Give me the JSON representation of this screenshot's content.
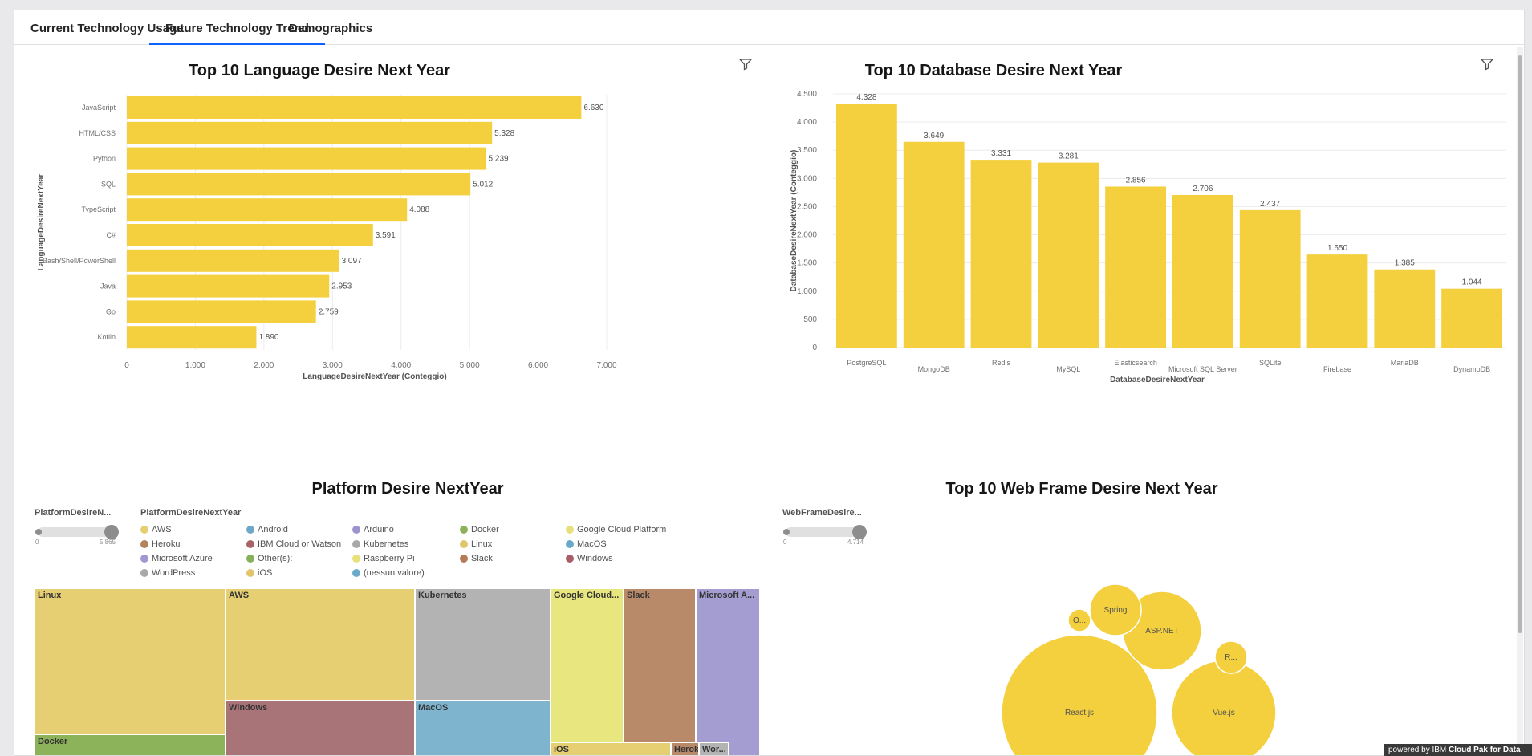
{
  "tabs": [
    {
      "label": "Current Technology Usage"
    },
    {
      "label": "Future Technology Trend"
    },
    {
      "label": "Demographics"
    }
  ],
  "colors": {
    "bar": "#f4d03f",
    "tab_accent": "#0f62fe"
  },
  "charts": {
    "language": {
      "title": "Top 10 Language Desire Next Year",
      "xlabel": "LanguageDesireNextYear (Conteggio)",
      "ylabel": "LanguageDesireNextYear"
    },
    "database": {
      "title": "Top 10 Database Desire Next Year",
      "xlabel": "DatabaseDesireNextYear",
      "ylabel": "DatabaseDesireNextYear (Conteggio)"
    },
    "platform": {
      "title": "Platform Desire NextYear",
      "slider_label": "PlatformDesireN...",
      "slider_min": "0",
      "slider_max": "5.865",
      "legend_title": "PlatformDesireNextYear"
    },
    "webframe": {
      "title": "Top 10 Web Frame Desire Next Year",
      "slider_label": "WebFrameDesire...",
      "slider_min": "0",
      "slider_max": "4.714"
    }
  },
  "chart_data": [
    {
      "type": "bar",
      "orientation": "horizontal",
      "title": "Top 10 Language Desire Next Year",
      "xlabel": "LanguageDesireNextYear (Conteggio)",
      "ylabel": "LanguageDesireNextYear",
      "categories": [
        "JavaScript",
        "HTML/CSS",
        "Python",
        "SQL",
        "TypeScript",
        "C#",
        "Bash/Shell/PowerShell",
        "Java",
        "Go",
        "Kotlin"
      ],
      "values": [
        6630,
        5328,
        5239,
        5012,
        4088,
        3591,
        3097,
        2953,
        2759,
        1890
      ],
      "value_labels": [
        "6.630",
        "5.328",
        "5.239",
        "5.012",
        "4.088",
        "3.591",
        "3.097",
        "2.953",
        "2.759",
        "1.890"
      ],
      "xlim": [
        0,
        7000
      ],
      "ticks": [
        "0",
        "1.000",
        "2.000",
        "3.000",
        "4.000",
        "5.000",
        "6.000",
        "7.000"
      ],
      "grid": true
    },
    {
      "type": "bar",
      "orientation": "vertical",
      "title": "Top 10 Database Desire Next Year",
      "xlabel": "DatabaseDesireNextYear",
      "ylabel": "DatabaseDesireNextYear (Conteggio)",
      "categories": [
        "PostgreSQL",
        "MongoDB",
        "Redis",
        "MySQL",
        "Elasticsearch",
        "Microsoft SQL Server",
        "SQLite",
        "Firebase",
        "MariaDB",
        "DynamoDB"
      ],
      "values": [
        4328,
        3649,
        3331,
        3281,
        2856,
        2706,
        2437,
        1650,
        1385,
        1044
      ],
      "value_labels": [
        "4.328",
        "3.649",
        "3.331",
        "3.281",
        "2.856",
        "2.706",
        "2.437",
        "1.650",
        "1.385",
        "1.044"
      ],
      "ylim": [
        0,
        4500
      ],
      "ticks": [
        "0",
        "500",
        "1.000",
        "1.500",
        "2.000",
        "2.500",
        "3.000",
        "3.500",
        "4.000",
        "4.500"
      ],
      "grid": true
    },
    {
      "type": "treemap",
      "title": "Platform Desire NextYear",
      "legend": [
        {
          "name": "AWS",
          "color": "#e6cf73"
        },
        {
          "name": "Android",
          "color": "#6ea7c8"
        },
        {
          "name": "Arduino",
          "color": "#9f93cf"
        },
        {
          "name": "Docker",
          "color": "#8db35a"
        },
        {
          "name": "Google Cloud Platform",
          "color": "#e8e07a"
        },
        {
          "name": "Heroku",
          "color": "#b5835a"
        },
        {
          "name": "IBM Cloud or Watson",
          "color": "#a86464"
        },
        {
          "name": "Kubernetes",
          "color": "#a8a8a8"
        },
        {
          "name": "Linux",
          "color": "#e0c56a"
        },
        {
          "name": "MacOS",
          "color": "#6aaac8"
        },
        {
          "name": "Microsoft Azure",
          "color": "#a297d3"
        },
        {
          "name": "Other(s):",
          "color": "#84b15a"
        },
        {
          "name": "Raspberry Pi",
          "color": "#e8e07a"
        },
        {
          "name": "Slack",
          "color": "#b57a56"
        },
        {
          "name": "Windows",
          "color": "#a85e66"
        },
        {
          "name": "WordPress",
          "color": "#a8a8a8"
        },
        {
          "name": "iOS",
          "color": "#e0c56a"
        },
        {
          "name": "(nessun valore)",
          "color": "#6aaac8"
        }
      ],
      "tiles": [
        {
          "label": "Linux",
          "color": "#e6cf73"
        },
        {
          "label": "Docker",
          "color": "#8db35a"
        },
        {
          "label": "AWS",
          "color": "#e6cf73"
        },
        {
          "label": "Windows",
          "color": "#a97478"
        },
        {
          "label": "Kubernetes",
          "color": "#b3b3b3"
        },
        {
          "label": "MacOS",
          "color": "#7fb4cf"
        },
        {
          "label": "Google Cloud...",
          "color": "#e8e67e"
        },
        {
          "label": "Slack",
          "color": "#b98a6a"
        },
        {
          "label": "Microsoft A...",
          "color": "#a49dd1"
        },
        {
          "label": "iOS",
          "color": "#e6cf73"
        },
        {
          "label": "Heroku",
          "color": "#b98a6a"
        },
        {
          "label": "Wor...",
          "color": "#b3b3b3"
        }
      ]
    },
    {
      "type": "bubble",
      "title": "Top 10 Web Frame Desire Next Year",
      "bubbles": [
        {
          "label": "React.js"
        },
        {
          "label": "Vue.js"
        },
        {
          "label": "ASP.NET"
        },
        {
          "label": "Spring"
        },
        {
          "label": "R..."
        },
        {
          "label": "O..."
        }
      ]
    }
  ],
  "powered_by": {
    "prefix": "powered by IBM",
    "brand": "Cloud Pak for Data"
  }
}
